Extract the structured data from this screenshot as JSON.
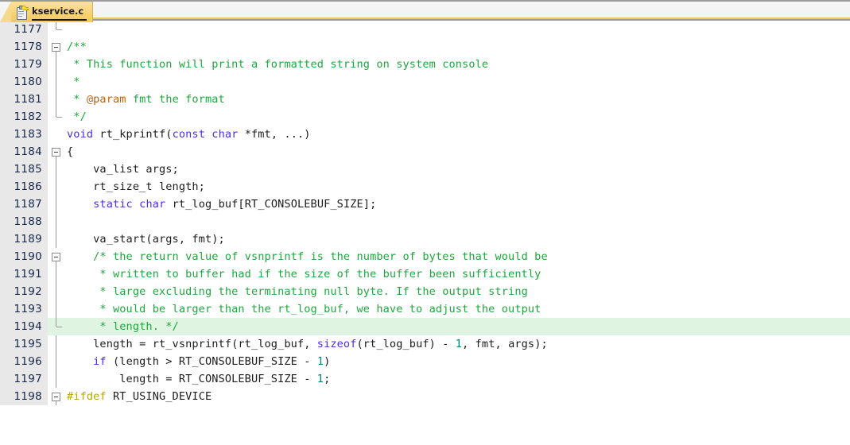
{
  "window": {
    "app": "code-editor",
    "accent_tab_color": "#f3c95e",
    "current_line_highlight": "#dff5e1"
  },
  "tabbar": {
    "tabs": [
      {
        "label": "kservice.c",
        "icon": "clipboard-key-icon",
        "active": true
      }
    ]
  },
  "editor": {
    "first_line_number": 1177,
    "current_line_number": 1194,
    "colors": {
      "keyword": "#4a2fe0",
      "comment": "#1ea83c",
      "doc_tag": "#b5651d",
      "number": "#00897b",
      "preprocessor": "#b8a800",
      "plain": "#1c1c1c",
      "gutter_bg": "#e8e8e8",
      "gutter_fg": "#18264a"
    },
    "lines": [
      {
        "number": "1177",
        "fold": "tick",
        "tokens": [
          {
            "t": "",
            "c": "pl"
          }
        ]
      },
      {
        "number": "1178",
        "fold": "box-open",
        "tokens": [
          {
            "t": "/**",
            "c": "cm"
          }
        ]
      },
      {
        "number": "1179",
        "fold": "line",
        "tokens": [
          {
            "t": " * This function will print a formatted string on system console",
            "c": "cm"
          }
        ]
      },
      {
        "number": "1180",
        "fold": "line",
        "tokens": [
          {
            "t": " *",
            "c": "cm"
          }
        ]
      },
      {
        "number": "1181",
        "fold": "line",
        "tokens": [
          {
            "t": " * ",
            "c": "cm"
          },
          {
            "t": "@param",
            "c": "doc"
          },
          {
            "t": " fmt the format",
            "c": "cm"
          }
        ]
      },
      {
        "number": "1182",
        "fold": "end",
        "tokens": [
          {
            "t": " */",
            "c": "cm"
          }
        ]
      },
      {
        "number": "1183",
        "fold": "none",
        "tokens": [
          {
            "t": "void",
            "c": "kw"
          },
          {
            "t": " rt_kprintf(",
            "c": "pl"
          },
          {
            "t": "const",
            "c": "kw"
          },
          {
            "t": " ",
            "c": "pl"
          },
          {
            "t": "char",
            "c": "kw"
          },
          {
            "t": " *fmt, ...)",
            "c": "pl"
          }
        ]
      },
      {
        "number": "1184",
        "fold": "box-open",
        "tokens": [
          {
            "t": "{",
            "c": "pl"
          }
        ]
      },
      {
        "number": "1185",
        "fold": "line",
        "tokens": [
          {
            "t": "    va_list args;",
            "c": "pl"
          }
        ]
      },
      {
        "number": "1186",
        "fold": "line",
        "tokens": [
          {
            "t": "    rt_size_t length;",
            "c": "pl"
          }
        ]
      },
      {
        "number": "1187",
        "fold": "line",
        "tokens": [
          {
            "t": "    ",
            "c": "pl"
          },
          {
            "t": "static",
            "c": "kw"
          },
          {
            "t": " ",
            "c": "pl"
          },
          {
            "t": "char",
            "c": "kw"
          },
          {
            "t": " rt_log_buf[RT_CONSOLEBUF_SIZE];",
            "c": "pl"
          }
        ]
      },
      {
        "number": "1188",
        "fold": "line",
        "tokens": [
          {
            "t": "",
            "c": "pl"
          }
        ]
      },
      {
        "number": "1189",
        "fold": "line",
        "tokens": [
          {
            "t": "    va_start(args, fmt);",
            "c": "pl"
          }
        ]
      },
      {
        "number": "1190",
        "fold": "box-open",
        "tokens": [
          {
            "t": "    /* the return value of vsnprintf is the number of bytes that would be",
            "c": "cm"
          }
        ]
      },
      {
        "number": "1191",
        "fold": "line",
        "tokens": [
          {
            "t": "     * written to buffer had if the size of the buffer been sufficiently",
            "c": "cm"
          }
        ]
      },
      {
        "number": "1192",
        "fold": "line",
        "tokens": [
          {
            "t": "     * large excluding the terminating null byte. If the output string",
            "c": "cm"
          }
        ]
      },
      {
        "number": "1193",
        "fold": "line",
        "tokens": [
          {
            "t": "     * would be larger than the rt_log_buf, we have to adjust the output",
            "c": "cm"
          }
        ]
      },
      {
        "number": "1194",
        "fold": "end",
        "current": true,
        "tokens": [
          {
            "t": "     * length. */",
            "c": "cm"
          }
        ]
      },
      {
        "number": "1195",
        "fold": "line",
        "tokens": [
          {
            "t": "    length = rt_vsnprintf(rt_log_buf, ",
            "c": "pl"
          },
          {
            "t": "sizeof",
            "c": "kw"
          },
          {
            "t": "(rt_log_buf) - ",
            "c": "pl"
          },
          {
            "t": "1",
            "c": "num"
          },
          {
            "t": ", fmt, args);",
            "c": "pl"
          }
        ]
      },
      {
        "number": "1196",
        "fold": "line",
        "tokens": [
          {
            "t": "    ",
            "c": "pl"
          },
          {
            "t": "if",
            "c": "kw"
          },
          {
            "t": " (length > RT_CONSOLEBUF_SIZE - ",
            "c": "pl"
          },
          {
            "t": "1",
            "c": "num"
          },
          {
            "t": ")",
            "c": "pl"
          }
        ]
      },
      {
        "number": "1197",
        "fold": "line",
        "tokens": [
          {
            "t": "        length = RT_CONSOLEBUF_SIZE - ",
            "c": "pl"
          },
          {
            "t": "1",
            "c": "num"
          },
          {
            "t": ";",
            "c": "pl"
          }
        ]
      },
      {
        "number": "1198",
        "fold": "box-open",
        "tokens": [
          {
            "t": "#ifdef",
            "c": "pp"
          },
          {
            "t": " RT_USING_DEVICE",
            "c": "pl"
          }
        ]
      }
    ]
  }
}
